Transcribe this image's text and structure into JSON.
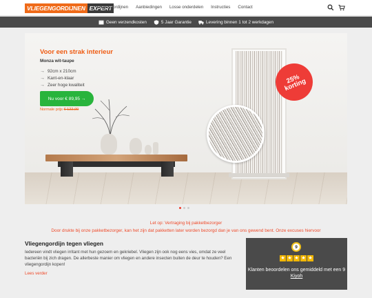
{
  "brand": {
    "part1": "VLIEGENGORDIJNEN",
    "part2": "EXPERT"
  },
  "nav": {
    "items": [
      "Vliegengordijnen",
      "Aanbiedingen",
      "Losse onderdelen",
      "Instructies",
      "Contact"
    ],
    "search_icon": "search-icon",
    "cart_icon": "cart-icon"
  },
  "usp": {
    "shipping": "Geen verzendkosten",
    "warranty": "5 Jaar Garantie",
    "delivery": "Levering binnen 1 tot 2 werkdagen"
  },
  "hero": {
    "title": "Voor een strak interieur",
    "subtitle": "Monza wit-taupe",
    "features": [
      "92cm x 210cm",
      "Kant-en-klaar",
      "Zeer hoge kwaliteit"
    ],
    "cta": "Nu voor € 89,95 →",
    "normal_label": "Normale prijs",
    "normal_price": "€ 122,00",
    "badge_top": "25%",
    "badge_bottom": "korting",
    "slides": 3,
    "active_slide": 1
  },
  "notices": {
    "line1": "Let op: Vertraging bij pakketbezorger",
    "line2": "Door drukte bij onze pakketbezorger, kan het zijn dat pakketten later worden bezorgd dan je van ons gewend bent. Onze excuses hiervoor"
  },
  "content": {
    "title": "Vliegengordijn tegen vliegen",
    "paragraph": "Iedereen vindt vliegen irritant met hun gezoem en gekriebel. Vliegen zijn ook nog eens vies, omdat ze veel bacteriën bij zich dragen. De allerbeste manier om vliegen en andere insecten buiten de deur te houden? Een vliegengordijn kopen!",
    "read_more": "Lees verder"
  },
  "kiyoh": {
    "score": "9",
    "stars": 5,
    "text": "Klanten beoordelen ons gemiddeld met een 9",
    "link": "Kiyoh"
  },
  "colors": {
    "accent": "#ef5b12",
    "cta_green": "#28b43c",
    "badge_red": "#ee3c37",
    "dark_bar": "#4a4a4a"
  }
}
